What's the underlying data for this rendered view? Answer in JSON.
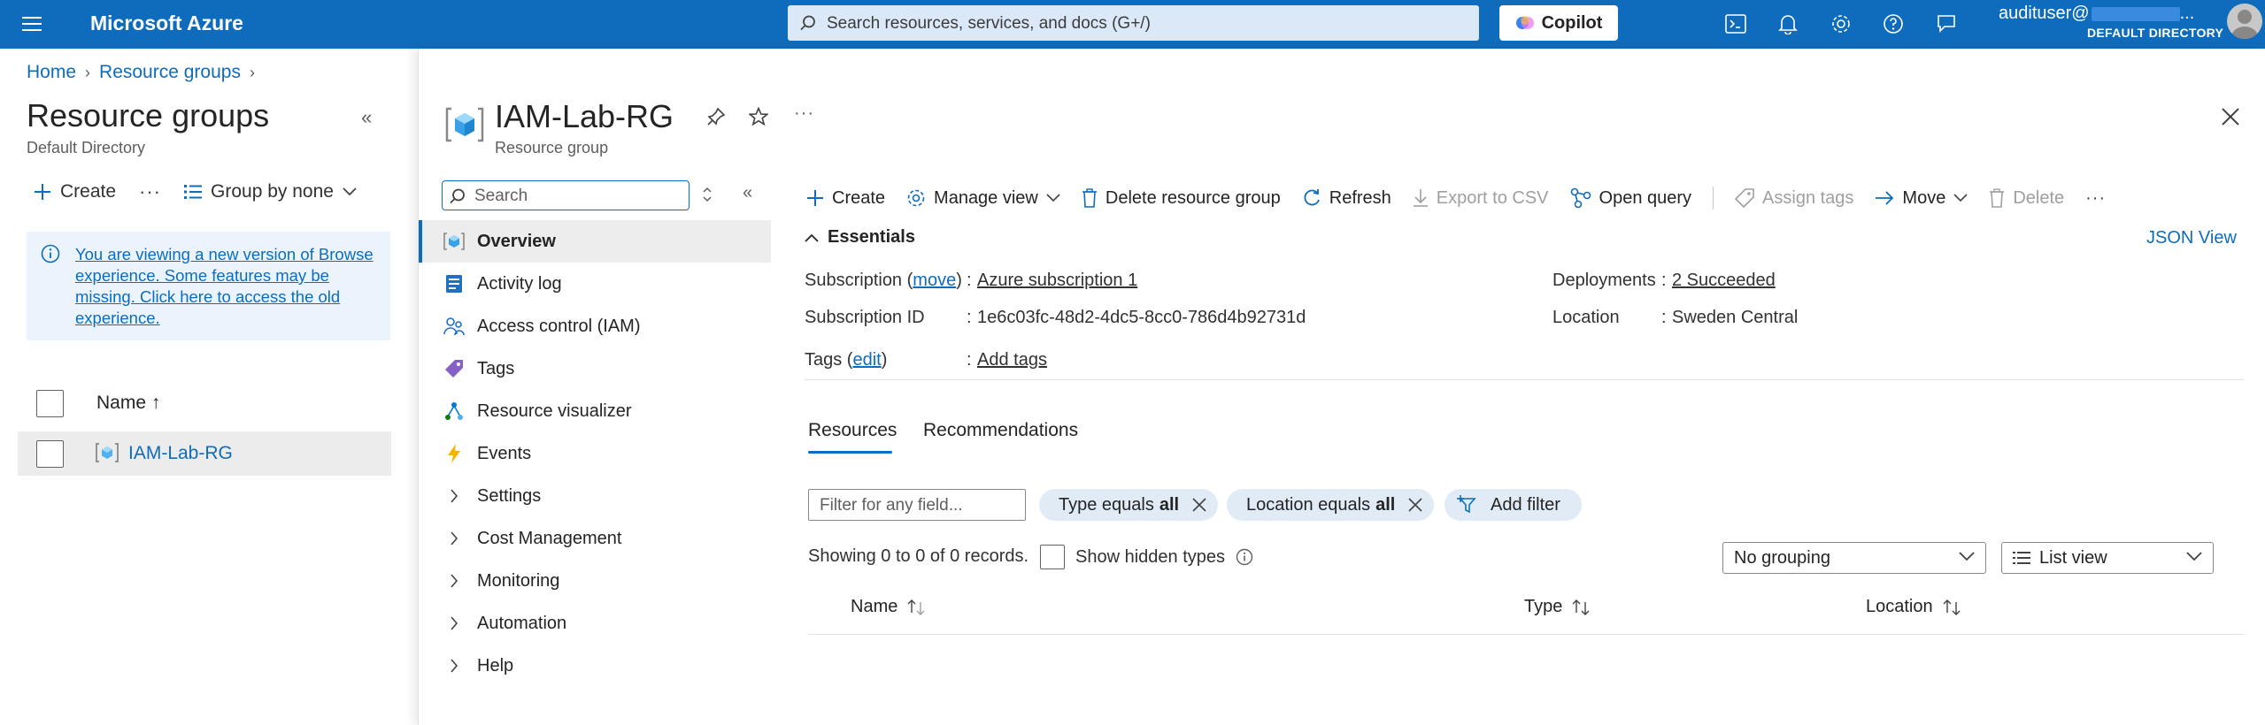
{
  "topbar": {
    "brand": "Microsoft Azure",
    "search_placeholder": "Search resources, services, and docs (G+/)",
    "copilot_label": "Copilot",
    "user_name": "audituser@",
    "user_name_tail": "...",
    "directory": "DEFAULT DIRECTORY"
  },
  "breadcrumb": {
    "home": "Home",
    "resource_groups": "Resource groups"
  },
  "left_blade": {
    "title": "Resource groups",
    "subtitle": "Default Directory",
    "create_label": "Create",
    "group_by_label": "Group by none",
    "info_text": "You are viewing a new version of Browse experience. Some features may be missing. Click here to access the old experience.",
    "column_name": "Name ↑",
    "rows": [
      {
        "name": "IAM-Lab-RG"
      }
    ]
  },
  "main_blade": {
    "title": "IAM-Lab-RG",
    "subtitle": "Resource group",
    "menu_search_placeholder": "Search",
    "menu": [
      {
        "label": "Overview",
        "icon": "resource-group-icon"
      },
      {
        "label": "Activity log",
        "icon": "activity-log-icon"
      },
      {
        "label": "Access control (IAM)",
        "icon": "people-icon"
      },
      {
        "label": "Tags",
        "icon": "tag-icon"
      },
      {
        "label": "Resource visualizer",
        "icon": "visualizer-icon"
      },
      {
        "label": "Events",
        "icon": "lightning-icon"
      },
      {
        "label": "Settings",
        "icon": "chevron-right-icon"
      },
      {
        "label": "Cost Management",
        "icon": "chevron-right-icon"
      },
      {
        "label": "Monitoring",
        "icon": "chevron-right-icon"
      },
      {
        "label": "Automation",
        "icon": "chevron-right-icon"
      },
      {
        "label": "Help",
        "icon": "chevron-right-icon"
      }
    ],
    "commands": {
      "create": "Create",
      "manage_view": "Manage view",
      "delete_rg": "Delete resource group",
      "refresh": "Refresh",
      "export_csv": "Export to CSV",
      "open_query": "Open query",
      "assign_tags": "Assign tags",
      "move": "Move",
      "delete": "Delete"
    },
    "essentials": {
      "header": "Essentials",
      "json_view": "JSON View",
      "subscription_label": "Subscription",
      "move_link": "move",
      "subscription_value": "Azure subscription 1",
      "subscription_id_label": "Subscription ID",
      "subscription_id_value": "1e6c03fc-48d2-4dc5-8cc0-786d4b92731d",
      "tags_label": "Tags",
      "edit_link": "edit",
      "tags_value": "Add tags",
      "deployments_label": "Deployments",
      "deployments_value": "2 Succeeded",
      "location_label": "Location",
      "location_value": "Sweden Central"
    },
    "tabs": {
      "resources": "Resources",
      "recommendations": "Recommendations"
    },
    "filters": {
      "placeholder": "Filter for any field...",
      "type_prefix": "Type equals",
      "type_value": "all",
      "location_prefix": "Location equals",
      "location_value": "all",
      "add_filter": "Add filter"
    },
    "records_text": "Showing 0 to 0 of 0 records.",
    "show_hidden": "Show hidden types",
    "grouping": "No grouping",
    "view": "List view",
    "columns": {
      "name": "Name",
      "type": "Type",
      "location": "Location"
    }
  },
  "colors": {
    "accent": "#0f6cbd",
    "topbar": "#0f6cbd"
  }
}
